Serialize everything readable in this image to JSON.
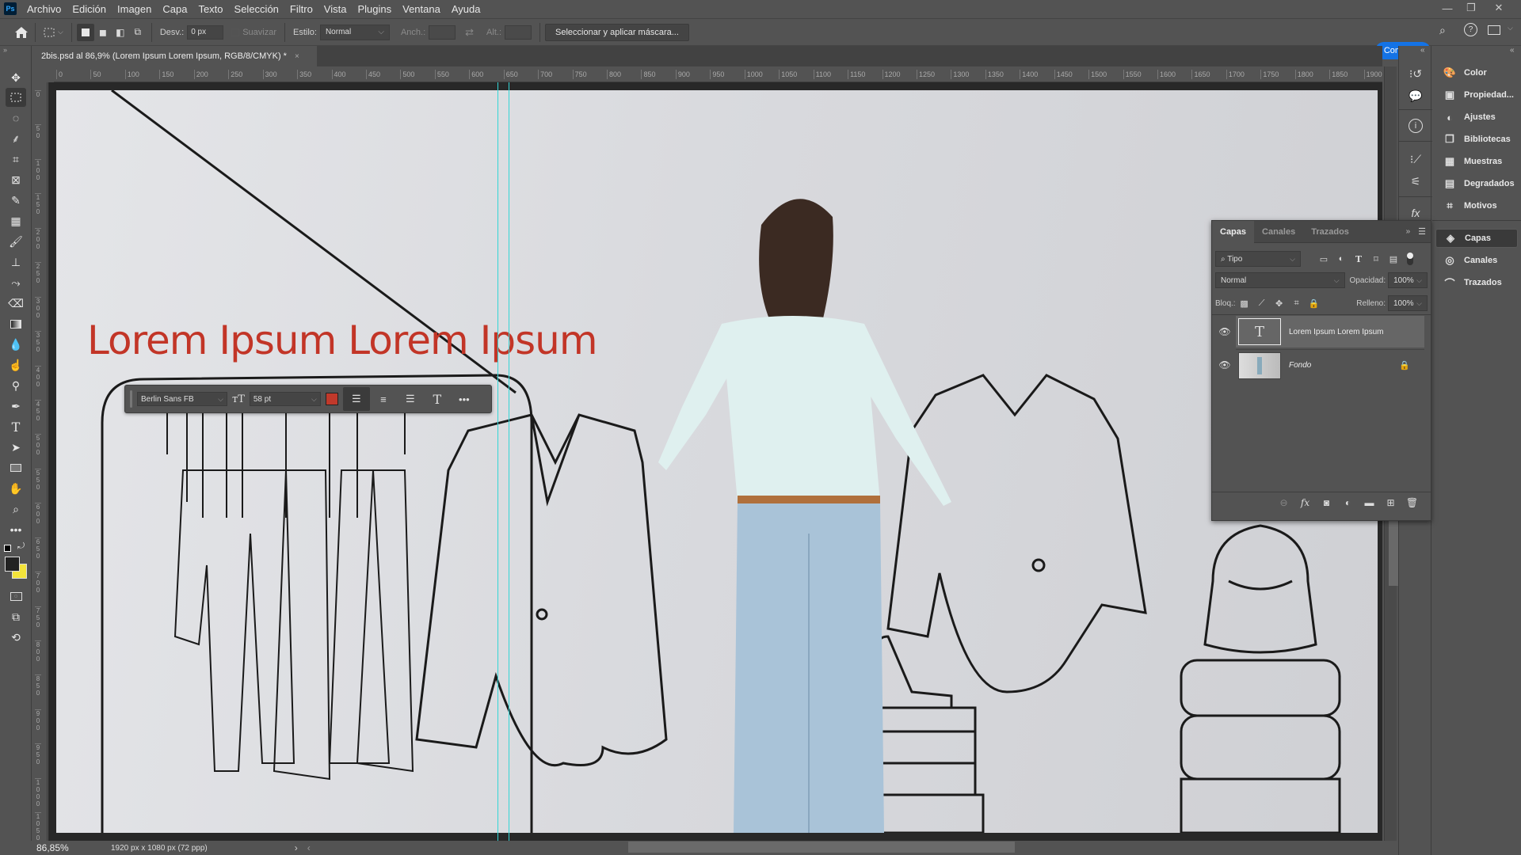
{
  "app": {
    "logo": "Ps"
  },
  "menu": [
    "Archivo",
    "Edición",
    "Imagen",
    "Capa",
    "Texto",
    "Selección",
    "Filtro",
    "Vista",
    "Plugins",
    "Ventana",
    "Ayuda"
  ],
  "window_controls": {
    "minimize": "—",
    "restore": "❐",
    "close": "✕"
  },
  "options_bar": {
    "feather_label": "Desv.:",
    "feather_value": "0 px",
    "antialias_label": "Suavizar",
    "style_label": "Estilo:",
    "style_value": "Normal",
    "width_label": "Anch.:",
    "height_label": "Alt.:",
    "mask_button": "Seleccionar y aplicar máscara...",
    "share_button": "Compartir"
  },
  "document_tab": {
    "title": "2bis.psd al 86,9% (Lorem Ipsum Lorem Ipsum, RGB/8/CMYK) *",
    "close": "×"
  },
  "ruler": {
    "top_ticks": [
      "0",
      "50",
      "100",
      "150",
      "200",
      "250",
      "300",
      "350",
      "400",
      "450",
      "500",
      "550",
      "600",
      "650",
      "700",
      "750",
      "800",
      "850",
      "900",
      "950",
      "1000",
      "1050",
      "1100",
      "1150",
      "1200",
      "1250",
      "1300",
      "1350",
      "1400",
      "1450",
      "1500",
      "1550",
      "1600",
      "1650",
      "1700",
      "1750",
      "1800",
      "1850",
      "1900"
    ],
    "left_ticks": [
      "0",
      "50",
      "100",
      "150",
      "200",
      "250",
      "300",
      "350",
      "400",
      "450",
      "500",
      "550",
      "600",
      "650",
      "700",
      "750",
      "800",
      "850",
      "900",
      "950",
      "1000",
      "1050"
    ]
  },
  "canvas": {
    "headline": "Lorem Ipsum Lorem Ipsum",
    "headline_color": "#c23527"
  },
  "text_toolbar": {
    "font": "Berlin Sans FB",
    "size": "58 pt",
    "color": "#c0392b",
    "align": "left",
    "more": "•••"
  },
  "status_bar": {
    "zoom": "86,85%",
    "doc_info": "1920 px x 1080 px (72 ppp)"
  },
  "right_panels": {
    "group1": [
      "Color",
      "Propiedad...",
      "Ajustes",
      "Bibliotecas",
      "Muestras",
      "Degradados",
      "Motivos"
    ],
    "group2": [
      "Capas",
      "Canales",
      "Trazados"
    ],
    "active": "Capas"
  },
  "layers_panel": {
    "tabs": [
      "Capas",
      "Canales",
      "Trazados"
    ],
    "active_tab": "Capas",
    "filter_kind": "Tipo",
    "blend_mode": "Normal",
    "opacity_label": "Opacidad:",
    "opacity_value": "100%",
    "lock_label": "Bloq.:",
    "fill_label": "Relleno:",
    "fill_value": "100%",
    "layers": [
      {
        "name": "Lorem Ipsum Lorem Ipsum",
        "type": "text",
        "visible": true,
        "selected": true,
        "locked": false
      },
      {
        "name": "Fondo",
        "type": "image",
        "visible": true,
        "selected": false,
        "locked": true
      }
    ]
  },
  "colors": {
    "foreground": "#222222",
    "background": "#f3e33a",
    "accent": "#1473e6",
    "guide": "#33d6d6"
  }
}
